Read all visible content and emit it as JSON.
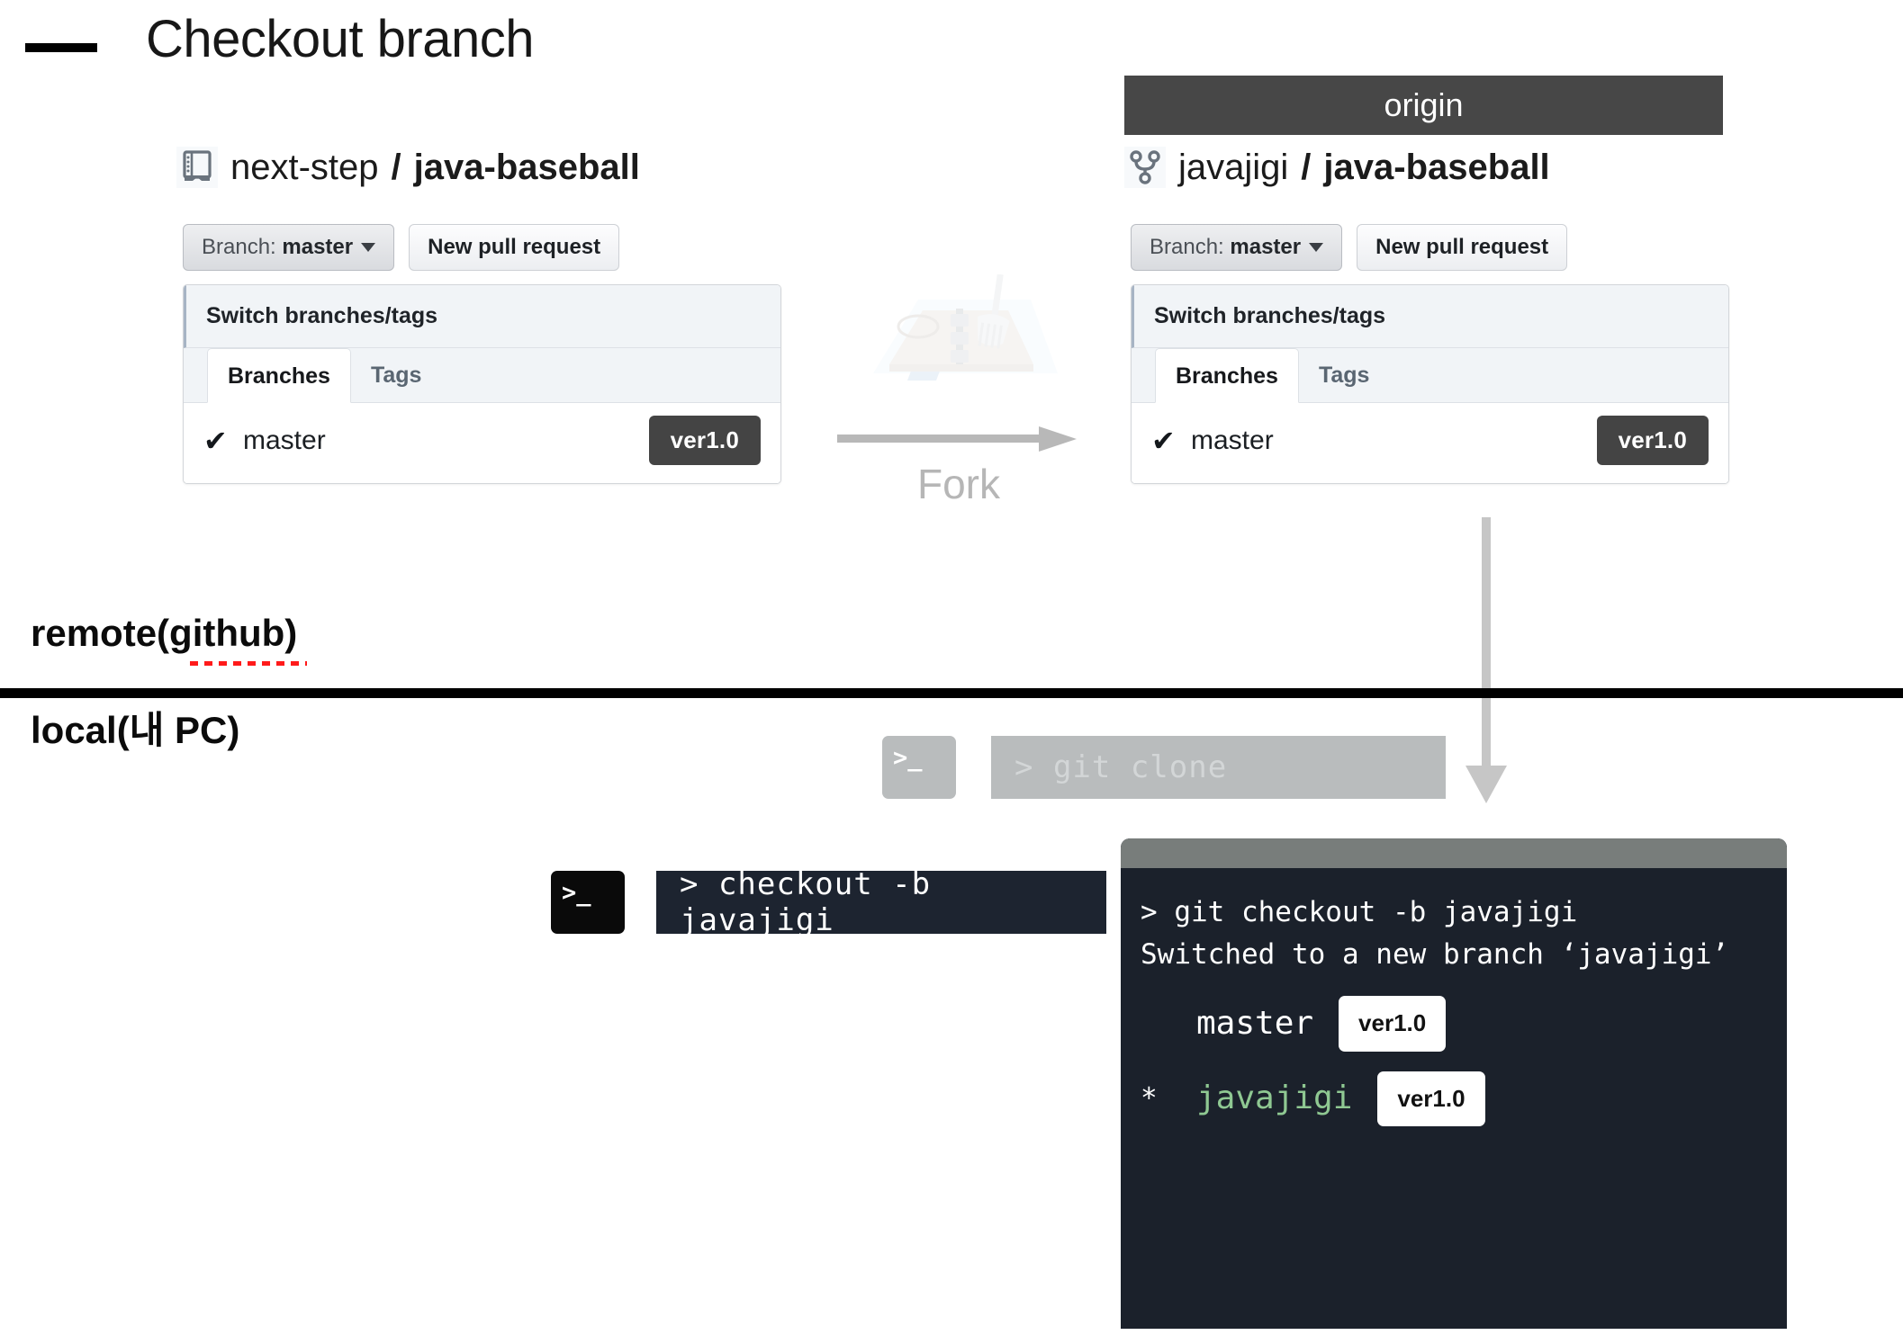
{
  "page": {
    "title": "Checkout branch"
  },
  "zones": {
    "remote_label": "remote(github)",
    "local_label": "local(내 PC)"
  },
  "fork": {
    "label": "Fork",
    "icon": "fork-illustration"
  },
  "left_repo": {
    "icon": "repo-book-icon",
    "owner": "next-step",
    "separator": "/",
    "name": "java-baseball",
    "branch_button": {
      "prefix": "Branch: ",
      "value": "master",
      "caret": "chevron-down-icon"
    },
    "pull_request_button": "New pull request",
    "dropdown": {
      "header": "Switch branches/tags",
      "tabs": [
        {
          "label": "Branches",
          "active": true
        },
        {
          "label": "Tags",
          "active": false
        }
      ],
      "rows": [
        {
          "check": "✔",
          "name": "master",
          "badge": "ver1.0"
        }
      ]
    }
  },
  "right_repo": {
    "header": "origin",
    "icon": "repo-fork-icon",
    "owner": "javajigi",
    "separator": "/",
    "name": "java-baseball",
    "branch_button": {
      "prefix": "Branch: ",
      "value": "master",
      "caret": "chevron-down-icon"
    },
    "pull_request_button": "New pull request",
    "dropdown": {
      "header": "Switch branches/tags",
      "tabs": [
        {
          "label": "Branches",
          "active": true
        },
        {
          "label": "Tags",
          "active": false
        }
      ],
      "rows": [
        {
          "check": "✔",
          "name": "master",
          "badge": "ver1.0"
        }
      ]
    }
  },
  "clone_command": {
    "icon_glyph": ">_",
    "text": "> git clone",
    "state": "faded"
  },
  "checkout_command": {
    "icon_glyph": ">_",
    "text": "> checkout -b javajigi",
    "state": "active"
  },
  "terminal": {
    "lines": [
      "> git checkout -b javajigi",
      "Switched to a new branch ‘javajigi’"
    ],
    "branches": [
      {
        "marker": " ",
        "name": "master",
        "badge": "ver1.0",
        "current": false
      },
      {
        "marker": "*",
        "name": "javajigi",
        "badge": "ver1.0",
        "current": true
      }
    ]
  },
  "colors": {
    "origin_bar": "#474747",
    "badge_dark": "#444444",
    "terminal_bg": "#1b212b",
    "terminal_titlebar": "#787d7b",
    "branch_green": "#8fc892",
    "command_bar": "#1d2430",
    "faded_gray": "#b9bcbd",
    "spellcheck_red": "#ff1a1a"
  }
}
